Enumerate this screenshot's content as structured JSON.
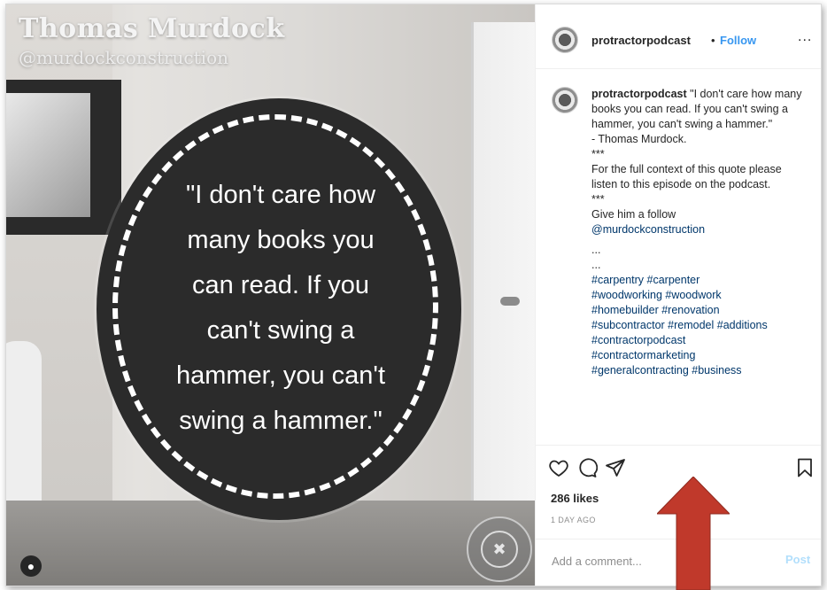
{
  "image": {
    "name_overlay": "Thomas Murdock",
    "handle_overlay": "@murdockconstruction",
    "quote_lines": [
      "\"I don't care how",
      "many books you",
      "can read. If you",
      "can't swing a",
      "hammer, you can't",
      "swing a hammer.\""
    ],
    "badge_icon": "podcast-logo-icon"
  },
  "header": {
    "username": "protractorpodcast",
    "separator": "•",
    "follow_label": "Follow",
    "more_label": "..."
  },
  "caption": {
    "username": "protractorpodcast",
    "lines": [
      "\"I don't care how many books you can read. If you can't swing a hammer, you can't swing a hammer.\"",
      "- Thomas Murdock.",
      "***",
      "For the full context of this quote please listen to this episode on the podcast.",
      "***",
      "Give him a follow",
      "@murdockconstruction",
      "...",
      "...",
      "#carpentry #carpenter",
      "#woodworking #woodwork",
      "#homebuilder #renovation",
      "#subcontractor #remodel #additions",
      "#contractorpodcast",
      "#contractormarketing",
      "#generalcontracting #business"
    ]
  },
  "actions": {
    "likes": "286 likes",
    "posted_ago": "1 DAY AGO",
    "icons": [
      "heart-icon",
      "comment-icon",
      "share-icon",
      "bookmark-icon"
    ]
  },
  "comment": {
    "placeholder": "Add a comment...",
    "post_label": "Post"
  },
  "colors": {
    "follow": "#3897f0",
    "post_disabled": "#b2dffc",
    "link": "#00376b",
    "arrow": "#c0392b"
  }
}
